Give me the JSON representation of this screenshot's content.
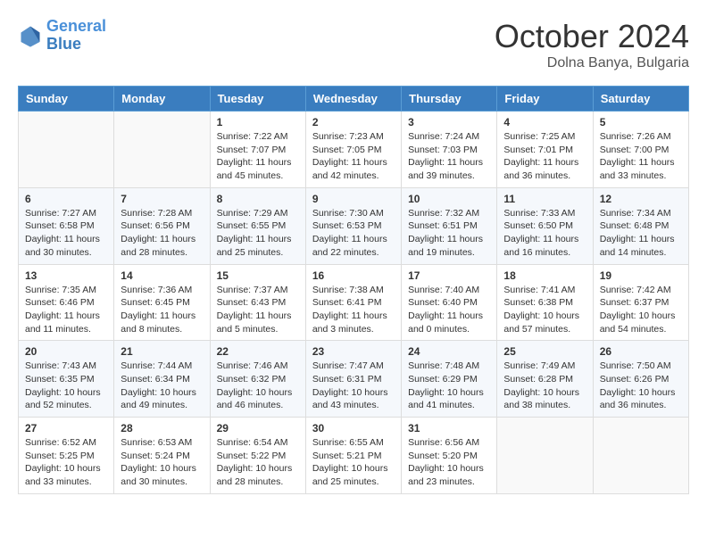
{
  "header": {
    "logo_line1": "General",
    "logo_line2": "Blue",
    "month_title": "October 2024",
    "location": "Dolna Banya, Bulgaria"
  },
  "weekdays": [
    "Sunday",
    "Monday",
    "Tuesday",
    "Wednesday",
    "Thursday",
    "Friday",
    "Saturday"
  ],
  "weeks": [
    [
      {
        "day": "",
        "sunrise": "",
        "sunset": "",
        "daylight": ""
      },
      {
        "day": "",
        "sunrise": "",
        "sunset": "",
        "daylight": ""
      },
      {
        "day": "1",
        "sunrise": "Sunrise: 7:22 AM",
        "sunset": "Sunset: 7:07 PM",
        "daylight": "Daylight: 11 hours and 45 minutes."
      },
      {
        "day": "2",
        "sunrise": "Sunrise: 7:23 AM",
        "sunset": "Sunset: 7:05 PM",
        "daylight": "Daylight: 11 hours and 42 minutes."
      },
      {
        "day": "3",
        "sunrise": "Sunrise: 7:24 AM",
        "sunset": "Sunset: 7:03 PM",
        "daylight": "Daylight: 11 hours and 39 minutes."
      },
      {
        "day": "4",
        "sunrise": "Sunrise: 7:25 AM",
        "sunset": "Sunset: 7:01 PM",
        "daylight": "Daylight: 11 hours and 36 minutes."
      },
      {
        "day": "5",
        "sunrise": "Sunrise: 7:26 AM",
        "sunset": "Sunset: 7:00 PM",
        "daylight": "Daylight: 11 hours and 33 minutes."
      }
    ],
    [
      {
        "day": "6",
        "sunrise": "Sunrise: 7:27 AM",
        "sunset": "Sunset: 6:58 PM",
        "daylight": "Daylight: 11 hours and 30 minutes."
      },
      {
        "day": "7",
        "sunrise": "Sunrise: 7:28 AM",
        "sunset": "Sunset: 6:56 PM",
        "daylight": "Daylight: 11 hours and 28 minutes."
      },
      {
        "day": "8",
        "sunrise": "Sunrise: 7:29 AM",
        "sunset": "Sunset: 6:55 PM",
        "daylight": "Daylight: 11 hours and 25 minutes."
      },
      {
        "day": "9",
        "sunrise": "Sunrise: 7:30 AM",
        "sunset": "Sunset: 6:53 PM",
        "daylight": "Daylight: 11 hours and 22 minutes."
      },
      {
        "day": "10",
        "sunrise": "Sunrise: 7:32 AM",
        "sunset": "Sunset: 6:51 PM",
        "daylight": "Daylight: 11 hours and 19 minutes."
      },
      {
        "day": "11",
        "sunrise": "Sunrise: 7:33 AM",
        "sunset": "Sunset: 6:50 PM",
        "daylight": "Daylight: 11 hours and 16 minutes."
      },
      {
        "day": "12",
        "sunrise": "Sunrise: 7:34 AM",
        "sunset": "Sunset: 6:48 PM",
        "daylight": "Daylight: 11 hours and 14 minutes."
      }
    ],
    [
      {
        "day": "13",
        "sunrise": "Sunrise: 7:35 AM",
        "sunset": "Sunset: 6:46 PM",
        "daylight": "Daylight: 11 hours and 11 minutes."
      },
      {
        "day": "14",
        "sunrise": "Sunrise: 7:36 AM",
        "sunset": "Sunset: 6:45 PM",
        "daylight": "Daylight: 11 hours and 8 minutes."
      },
      {
        "day": "15",
        "sunrise": "Sunrise: 7:37 AM",
        "sunset": "Sunset: 6:43 PM",
        "daylight": "Daylight: 11 hours and 5 minutes."
      },
      {
        "day": "16",
        "sunrise": "Sunrise: 7:38 AM",
        "sunset": "Sunset: 6:41 PM",
        "daylight": "Daylight: 11 hours and 3 minutes."
      },
      {
        "day": "17",
        "sunrise": "Sunrise: 7:40 AM",
        "sunset": "Sunset: 6:40 PM",
        "daylight": "Daylight: 11 hours and 0 minutes."
      },
      {
        "day": "18",
        "sunrise": "Sunrise: 7:41 AM",
        "sunset": "Sunset: 6:38 PM",
        "daylight": "Daylight: 10 hours and 57 minutes."
      },
      {
        "day": "19",
        "sunrise": "Sunrise: 7:42 AM",
        "sunset": "Sunset: 6:37 PM",
        "daylight": "Daylight: 10 hours and 54 minutes."
      }
    ],
    [
      {
        "day": "20",
        "sunrise": "Sunrise: 7:43 AM",
        "sunset": "Sunset: 6:35 PM",
        "daylight": "Daylight: 10 hours and 52 minutes."
      },
      {
        "day": "21",
        "sunrise": "Sunrise: 7:44 AM",
        "sunset": "Sunset: 6:34 PM",
        "daylight": "Daylight: 10 hours and 49 minutes."
      },
      {
        "day": "22",
        "sunrise": "Sunrise: 7:46 AM",
        "sunset": "Sunset: 6:32 PM",
        "daylight": "Daylight: 10 hours and 46 minutes."
      },
      {
        "day": "23",
        "sunrise": "Sunrise: 7:47 AM",
        "sunset": "Sunset: 6:31 PM",
        "daylight": "Daylight: 10 hours and 43 minutes."
      },
      {
        "day": "24",
        "sunrise": "Sunrise: 7:48 AM",
        "sunset": "Sunset: 6:29 PM",
        "daylight": "Daylight: 10 hours and 41 minutes."
      },
      {
        "day": "25",
        "sunrise": "Sunrise: 7:49 AM",
        "sunset": "Sunset: 6:28 PM",
        "daylight": "Daylight: 10 hours and 38 minutes."
      },
      {
        "day": "26",
        "sunrise": "Sunrise: 7:50 AM",
        "sunset": "Sunset: 6:26 PM",
        "daylight": "Daylight: 10 hours and 36 minutes."
      }
    ],
    [
      {
        "day": "27",
        "sunrise": "Sunrise: 6:52 AM",
        "sunset": "Sunset: 5:25 PM",
        "daylight": "Daylight: 10 hours and 33 minutes."
      },
      {
        "day": "28",
        "sunrise": "Sunrise: 6:53 AM",
        "sunset": "Sunset: 5:24 PM",
        "daylight": "Daylight: 10 hours and 30 minutes."
      },
      {
        "day": "29",
        "sunrise": "Sunrise: 6:54 AM",
        "sunset": "Sunset: 5:22 PM",
        "daylight": "Daylight: 10 hours and 28 minutes."
      },
      {
        "day": "30",
        "sunrise": "Sunrise: 6:55 AM",
        "sunset": "Sunset: 5:21 PM",
        "daylight": "Daylight: 10 hours and 25 minutes."
      },
      {
        "day": "31",
        "sunrise": "Sunrise: 6:56 AM",
        "sunset": "Sunset: 5:20 PM",
        "daylight": "Daylight: 10 hours and 23 minutes."
      },
      {
        "day": "",
        "sunrise": "",
        "sunset": "",
        "daylight": ""
      },
      {
        "day": "",
        "sunrise": "",
        "sunset": "",
        "daylight": ""
      }
    ]
  ]
}
